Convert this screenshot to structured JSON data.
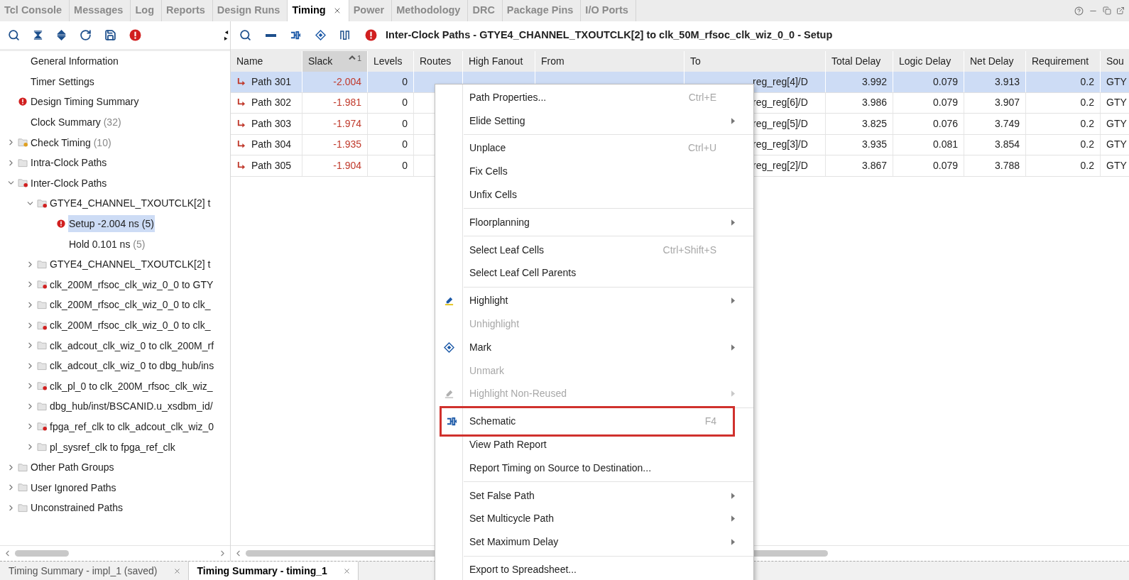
{
  "top_tabs": [
    {
      "label": "Tcl Console",
      "selected": false,
      "closable": false
    },
    {
      "label": "Messages",
      "selected": false,
      "closable": false
    },
    {
      "label": "Log",
      "selected": false,
      "closable": false
    },
    {
      "label": "Reports",
      "selected": false,
      "closable": false
    },
    {
      "label": "Design Runs",
      "selected": false,
      "closable": false
    },
    {
      "label": "Timing",
      "selected": true,
      "closable": true
    },
    {
      "label": "Power",
      "selected": false,
      "closable": false
    },
    {
      "label": "Methodology",
      "selected": false,
      "closable": false
    },
    {
      "label": "DRC",
      "selected": false,
      "closable": false
    },
    {
      "label": "Package Pins",
      "selected": false,
      "closable": false
    },
    {
      "label": "I/O Ports",
      "selected": false,
      "closable": false
    }
  ],
  "panel_title": "Inter-Clock Paths - GTYE4_CHANNEL_TXOUTCLK[2] to clk_50M_rfsoc_clk_wiz_0_0 - Setup",
  "tree": [
    {
      "label": "General Information",
      "selected": false
    },
    {
      "label": "Timer Settings",
      "selected": false
    },
    {
      "label": "Design Timing Summary",
      "kind": "error",
      "selected": false
    },
    {
      "label": "Clock Summary",
      "count": "(32)",
      "selected": false
    },
    {
      "label": "Check Timing",
      "count": "(10)",
      "kind": "folder-warning",
      "expanded": false,
      "selected": false
    },
    {
      "label": "Intra-Clock Paths",
      "kind": "folder",
      "expanded": false,
      "selected": false
    },
    {
      "label": "Inter-Clock Paths",
      "kind": "folder-error",
      "expanded": true,
      "selected": false,
      "children": [
        {
          "label": "GTYE4_CHANNEL_TXOUTCLK[2] t",
          "kind": "folder-error",
          "expanded": true,
          "selected": false,
          "children": [
            {
              "label": "Setup -2.004 ns (5)",
              "kind": "error",
              "selected": true
            },
            {
              "label": "Hold 0.101 ns",
              "count": "(5)",
              "selected": false
            }
          ]
        },
        {
          "label": "GTYE4_CHANNEL_TXOUTCLK[2] t",
          "kind": "folder",
          "expanded": false,
          "selected": false
        },
        {
          "label": "clk_200M_rfsoc_clk_wiz_0_0 to GTY",
          "kind": "folder-error",
          "expanded": false,
          "selected": false
        },
        {
          "label": "clk_200M_rfsoc_clk_wiz_0_0 to clk_",
          "kind": "folder",
          "expanded": false,
          "selected": false
        },
        {
          "label": "clk_200M_rfsoc_clk_wiz_0_0 to clk_",
          "kind": "folder-error",
          "expanded": false,
          "selected": false
        },
        {
          "label": "clk_adcout_clk_wiz_0 to clk_200M_rf",
          "kind": "folder",
          "expanded": false,
          "selected": false
        },
        {
          "label": "clk_adcout_clk_wiz_0 to dbg_hub/ins",
          "kind": "folder",
          "expanded": false,
          "selected": false
        },
        {
          "label": "clk_pl_0 to clk_200M_rfsoc_clk_wiz_",
          "kind": "folder-error",
          "expanded": false,
          "selected": false
        },
        {
          "label": "dbg_hub/inst/BSCANID.u_xsdbm_id/",
          "kind": "folder",
          "expanded": false,
          "selected": false
        },
        {
          "label": "fpga_ref_clk to clk_adcout_clk_wiz_0",
          "kind": "folder-error",
          "expanded": false,
          "selected": false
        },
        {
          "label": "pl_sysref_clk to fpga_ref_clk",
          "kind": "folder",
          "expanded": false,
          "selected": false
        }
      ]
    },
    {
      "label": "Other Path Groups",
      "kind": "folder",
      "expanded": false,
      "selected": false
    },
    {
      "label": "User Ignored Paths",
      "kind": "folder",
      "expanded": false,
      "selected": false
    },
    {
      "label": "Unconstrained Paths",
      "kind": "folder",
      "expanded": false,
      "selected": false
    }
  ],
  "table": {
    "columns": [
      {
        "label": "Name",
        "sorted": false
      },
      {
        "label": "Slack",
        "sorted": true,
        "sort_index": "1"
      },
      {
        "label": "Levels",
        "sorted": false
      },
      {
        "label": "Routes",
        "sorted": false
      },
      {
        "label": "High Fanout",
        "sorted": false
      },
      {
        "label": "From",
        "sorted": false
      },
      {
        "label": "To",
        "sorted": false
      },
      {
        "label": "Total Delay",
        "sorted": false
      },
      {
        "label": "Logic Delay",
        "sorted": false
      },
      {
        "label": "Net Delay",
        "sorted": false
      },
      {
        "label": "Requirement",
        "sorted": false
      },
      {
        "label": "Sou",
        "sorted": false
      }
    ],
    "rows": [
      {
        "selected": true,
        "name": "Path 301",
        "slack": "-2.004",
        "levels": "0",
        "to": "reg_reg[4]/D",
        "total_delay": "3.992",
        "logic_delay": "0.079",
        "net_delay": "3.913",
        "requirement": "0.2",
        "source": "GTY"
      },
      {
        "selected": false,
        "name": "Path 302",
        "slack": "-1.981",
        "levels": "0",
        "to": "reg_reg[6]/D",
        "total_delay": "3.986",
        "logic_delay": "0.079",
        "net_delay": "3.907",
        "requirement": "0.2",
        "source": "GTY"
      },
      {
        "selected": false,
        "name": "Path 303",
        "slack": "-1.974",
        "levels": "0",
        "to": "reg_reg[5]/D",
        "total_delay": "3.825",
        "logic_delay": "0.076",
        "net_delay": "3.749",
        "requirement": "0.2",
        "source": "GTY"
      },
      {
        "selected": false,
        "name": "Path 304",
        "slack": "-1.935",
        "levels": "0",
        "to": "reg_reg[3]/D",
        "total_delay": "3.935",
        "logic_delay": "0.081",
        "net_delay": "3.854",
        "requirement": "0.2",
        "source": "GTY"
      },
      {
        "selected": false,
        "name": "Path 305",
        "slack": "-1.904",
        "levels": "0",
        "to": "reg_reg[2]/D",
        "total_delay": "3.867",
        "logic_delay": "0.079",
        "net_delay": "3.788",
        "requirement": "0.2",
        "source": "GTY"
      }
    ]
  },
  "context_menu": [
    {
      "kind": "item",
      "label": "Path Properties...",
      "shortcut": "Ctrl+E",
      "submenu": false,
      "disabled": false
    },
    {
      "kind": "item",
      "label": "Elide Setting",
      "submenu": true,
      "disabled": false
    },
    {
      "kind": "separator"
    },
    {
      "kind": "item",
      "label": "Unplace",
      "shortcut": "Ctrl+U",
      "submenu": false,
      "disabled": false
    },
    {
      "kind": "item",
      "label": "Fix Cells",
      "submenu": false,
      "disabled": false
    },
    {
      "kind": "item",
      "label": "Unfix Cells",
      "submenu": false,
      "disabled": false
    },
    {
      "kind": "separator"
    },
    {
      "kind": "item",
      "label": "Floorplanning",
      "submenu": true,
      "disabled": false
    },
    {
      "kind": "separator"
    },
    {
      "kind": "item",
      "label": "Select Leaf Cells",
      "shortcut": "Ctrl+Shift+S",
      "submenu": false,
      "disabled": false
    },
    {
      "kind": "item",
      "label": "Select Leaf Cell Parents",
      "submenu": false,
      "disabled": false
    },
    {
      "kind": "separator"
    },
    {
      "kind": "highlight",
      "label": "Highlight",
      "submenu": true,
      "disabled": false
    },
    {
      "kind": "item",
      "label": "Unhighlight",
      "submenu": false,
      "disabled": true
    },
    {
      "kind": "mark",
      "label": "Mark",
      "submenu": true,
      "disabled": false
    },
    {
      "kind": "item",
      "label": "Unmark",
      "submenu": false,
      "disabled": true
    },
    {
      "kind": "highlight",
      "label": "Highlight Non-Reused",
      "submenu": true,
      "disabled": true
    },
    {
      "kind": "separator"
    },
    {
      "kind": "schematic",
      "label": "Schematic",
      "shortcut": "F4",
      "submenu": false,
      "disabled": false,
      "annotated": true
    },
    {
      "kind": "item",
      "label": "View Path Report",
      "submenu": false,
      "disabled": false
    },
    {
      "kind": "item",
      "label": "Report Timing on Source to Destination...",
      "submenu": false,
      "disabled": false
    },
    {
      "kind": "separator"
    },
    {
      "kind": "item",
      "label": "Set False Path",
      "submenu": true,
      "disabled": false
    },
    {
      "kind": "item",
      "label": "Set Multicycle Path",
      "submenu": true,
      "disabled": false
    },
    {
      "kind": "item",
      "label": "Set Maximum Delay",
      "submenu": true,
      "disabled": false
    },
    {
      "kind": "separator"
    },
    {
      "kind": "item",
      "label": "Export to Spreadsheet...",
      "submenu": false,
      "disabled": false
    }
  ],
  "bottom_tabs": [
    {
      "label": "Timing Summary - impl_1 (saved)",
      "selected": false
    },
    {
      "label": "Timing Summary - timing_1",
      "selected": true
    }
  ]
}
